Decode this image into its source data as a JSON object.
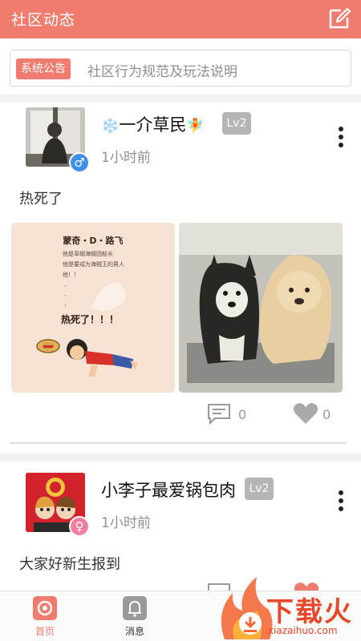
{
  "header": {
    "title": "社区动态",
    "edit_icon": "edit-icon",
    "color": "#ef7c6e"
  },
  "notice": {
    "badge": "系统公告",
    "text": "社区行为规范及玩法说明"
  },
  "posts": [
    {
      "name_prefix": "❄️",
      "name": "一介草民",
      "name_suffix": "🧚",
      "level": "Lv2",
      "time": "1小时前",
      "gender_symbol": "♂",
      "content": "热死了",
      "comments": "0",
      "likes": "0",
      "photo1": {
        "title": "蒙奇・D・路飞",
        "lines": [
          "他是草帽海贼团船长",
          "他是要成为海贼王的男人",
          "他！！"
        ],
        "dots": "·\n·\n·",
        "shout": "热死了！！！"
      }
    },
    {
      "name": "小李子最爱锅包肉",
      "level": "Lv2",
      "time": "1小时前",
      "gender_symbol": "♀",
      "content": "大家好新生报到"
    }
  ],
  "tabbar": {
    "items": [
      {
        "label": "首页",
        "active": true
      },
      {
        "label": "消息",
        "active": false
      }
    ]
  },
  "watermark": {
    "title": "下载火",
    "url": "xiazaihuo.com"
  }
}
